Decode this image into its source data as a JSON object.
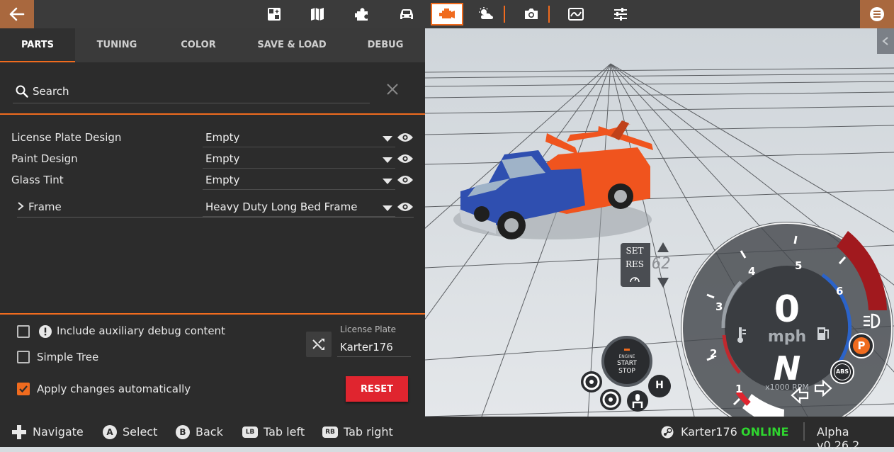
{
  "tabs": [
    "PARTS",
    "TUNING",
    "COLOR",
    "SAVE & LOAD",
    "DEBUG"
  ],
  "search": {
    "placeholder": "Search"
  },
  "parts": [
    {
      "label": "License Plate Design",
      "value": "Empty"
    },
    {
      "label": "Paint Design",
      "value": "Empty"
    },
    {
      "label": "Glass Tint",
      "value": "Empty"
    },
    {
      "label": "Frame",
      "value": "Heavy Duty Long Bed Frame"
    }
  ],
  "options": {
    "debug_label": "Include auxiliary debug content",
    "simple_tree_label": "Simple Tree",
    "auto_apply_label": "Apply changes automatically",
    "debug_checked": false,
    "simple_tree_checked": false,
    "auto_apply_checked": true
  },
  "license_plate": {
    "caption": "License Plate",
    "value": "Karter176"
  },
  "reset_label": "RESET",
  "hud": {
    "cruise_set": "SET",
    "cruise_res": "RES",
    "cruise_speed": "62",
    "speed": "0",
    "speed_unit": "mph",
    "gear": "N",
    "rpm_label": "x1000 RPM",
    "rpm_ticks": [
      "1",
      "2",
      "3",
      "4",
      "5",
      "6"
    ],
    "engine_line1": "ENGINE",
    "engine_line2": "START",
    "engine_line3": "STOP",
    "parking_label": "P",
    "abs_label": "ABS",
    "hbrake_label": "H"
  },
  "bottom_hints": [
    {
      "button": "dpad",
      "label": "Navigate"
    },
    {
      "button": "A",
      "label": "Select"
    },
    {
      "button": "B",
      "label": "Back"
    },
    {
      "button": "LB",
      "label": "Tab left"
    },
    {
      "button": "RB",
      "label": "Tab right"
    }
  ],
  "status": {
    "user": "Karter176",
    "online": "ONLINE",
    "version": "Alpha v0.26.2"
  },
  "colors": {
    "accent": "#f06b1e",
    "panel": "#2c2c2c",
    "reset": "#e0252f",
    "online": "#2fd52f",
    "truck_blue": "#2f4fb0",
    "truck_orange": "#f0541e"
  },
  "top_icons": [
    "environment-icon",
    "map-icon",
    "mods-icon",
    "vehicles-icon",
    "vehicle-config-icon",
    "weather-icon",
    "photo-mode-icon",
    "track-builder-icon",
    "options-icon"
  ]
}
